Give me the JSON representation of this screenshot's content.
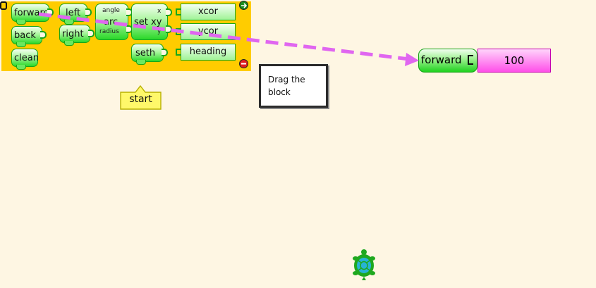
{
  "palette": {
    "blocks": {
      "forward": "forward",
      "left": "left",
      "set_arc": "arc",
      "set_arc_param1": "angle",
      "set_arc_param2": "radius",
      "set_xy": "set xy",
      "set_xy_param1": "x",
      "set_xy_param2": "y",
      "back": "back",
      "right": "right",
      "clean": "clean",
      "seth": "seth"
    },
    "fields": {
      "xcor": "xcor",
      "ycor": "ycor",
      "heading": "heading"
    }
  },
  "canvas": {
    "start_block": "start",
    "tooltip": "Drag the block",
    "placed_block_label": "forward",
    "placed_block_value": "100"
  },
  "colors": {
    "palette_bg": "#ffcc00",
    "canvas_bg": "#fef6e3",
    "block_green": "#2bd829",
    "value_magenta": "#ff4fe9",
    "drag_arrow": "#e066f0",
    "turtle": "#1fa81f"
  },
  "icons": {
    "palette_collapse": "collapse-palette-icon",
    "palette_up": "palette-up-icon",
    "palette_close": "palette-close-icon",
    "turtle": "turtle-icon"
  }
}
